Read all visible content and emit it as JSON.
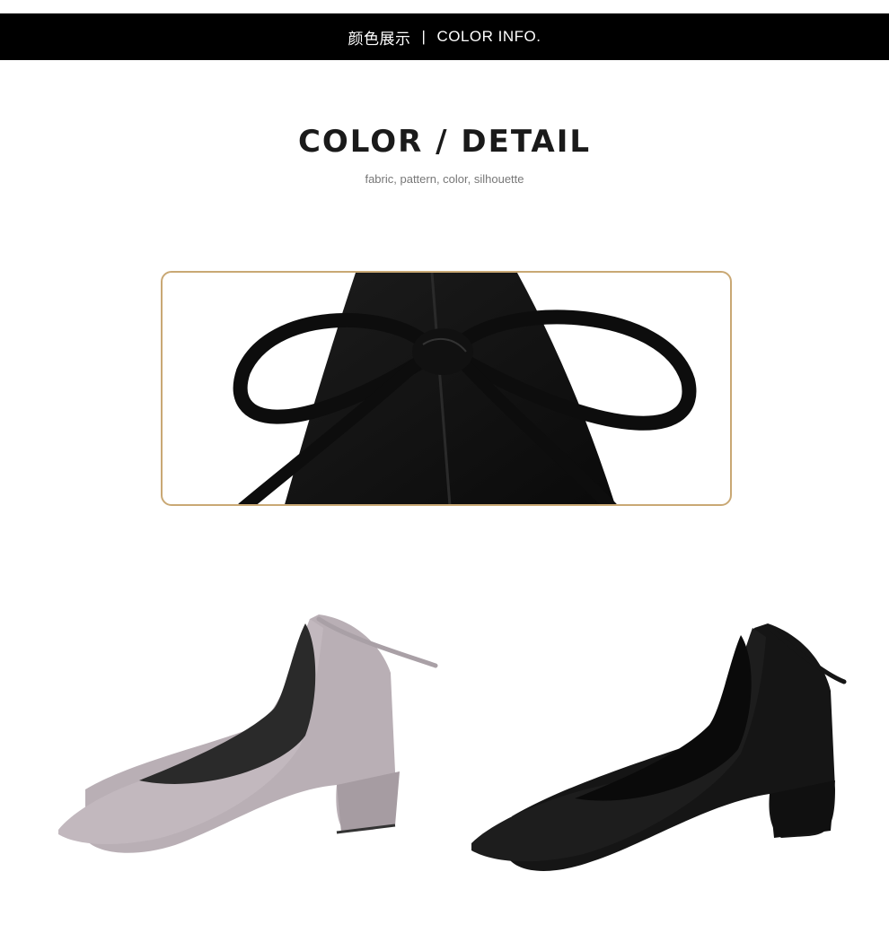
{
  "header": {
    "title_cn": "颜色展示",
    "separator": "|",
    "title_en": "COLOR INFO."
  },
  "section": {
    "title": "COLOR / DETAIL",
    "subtitle": "fabric, pattern, color, silhouette"
  },
  "colors": {
    "header_bg": "#000000",
    "frame_border": "#c9a874",
    "grey_suede": "#b7adb3",
    "black_suede": "#111111"
  }
}
